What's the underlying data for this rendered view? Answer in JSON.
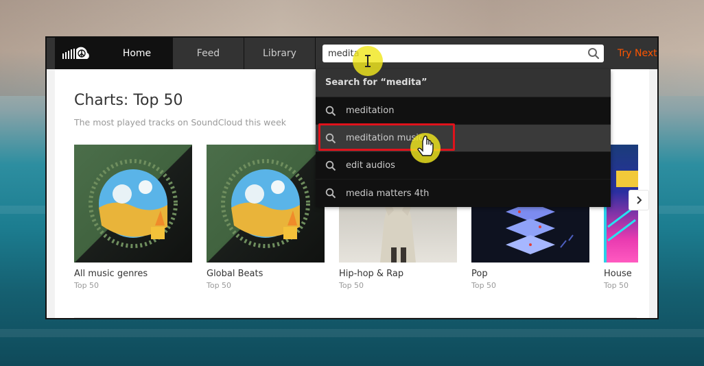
{
  "nav": {
    "home": "Home",
    "feed": "Feed",
    "library": "Library",
    "try_next": "Try Next P"
  },
  "search": {
    "value": "medita"
  },
  "dropdown": {
    "heading": "Search for “medita”",
    "suggestions": [
      {
        "label": "meditation"
      },
      {
        "label": "meditation music"
      },
      {
        "label": "edit audios"
      },
      {
        "label": "media matters 4th"
      }
    ]
  },
  "charts": {
    "title": "Charts: Top 50",
    "subtitle": "The most played tracks on SoundCloud this week",
    "cards": [
      {
        "name": "All music genres",
        "sub": "Top 50"
      },
      {
        "name": "Global Beats",
        "sub": "Top 50"
      },
      {
        "name": "Hip-hop & Rap",
        "sub": "Top 50"
      },
      {
        "name": "Pop",
        "sub": "Top 50"
      },
      {
        "name": "House",
        "sub": "Top 50"
      }
    ]
  },
  "colors": {
    "accent": "#ff5500",
    "header": "#333333",
    "highlight": "#e0121b",
    "cursor": "#f0e61e"
  }
}
